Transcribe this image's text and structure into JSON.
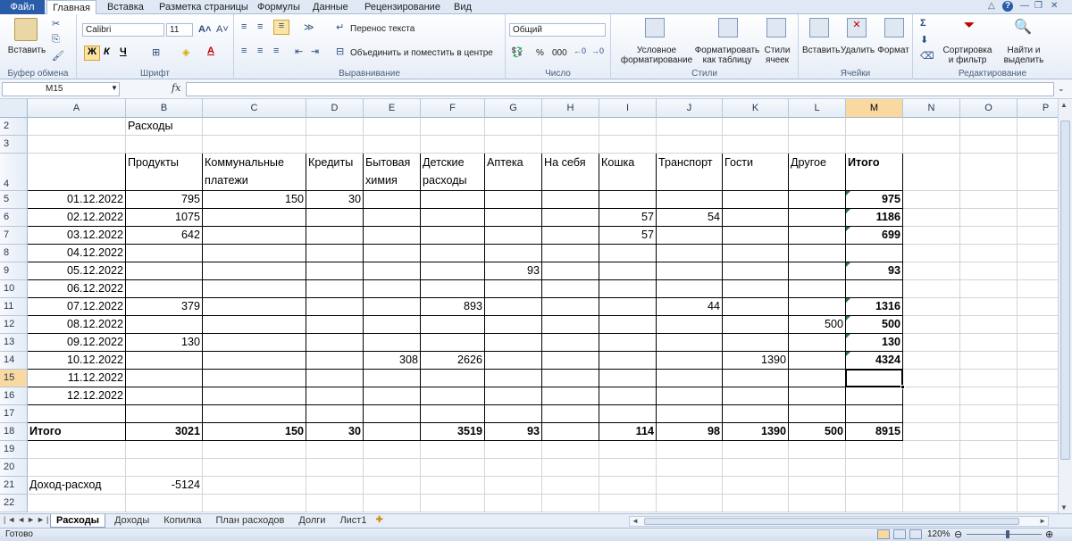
{
  "ribbon_tabs": [
    "Файл",
    "Главная",
    "Вставка",
    "Разметка страницы",
    "Формулы",
    "Данные",
    "Рецензирование",
    "Вид"
  ],
  "clipboard": {
    "paste": "Вставить",
    "label": "Буфер обмена"
  },
  "font": {
    "name": "Calibri",
    "size": "11",
    "bold": "Ж",
    "italic": "К",
    "underline": "Ч",
    "label": "Шрифт"
  },
  "alignment": {
    "wrap": "Перенос текста",
    "merge": "Объединить и поместить в центре",
    "label": "Выравнивание"
  },
  "number": {
    "format": "Общий",
    "percent": "%",
    "thousands": "000",
    "label": "Число"
  },
  "styles": {
    "conditional_1": "Условное",
    "conditional_2": "форматирование",
    "table_1": "Форматировать",
    "table_2": "как таблицу",
    "cell_1": "Стили",
    "cell_2": "ячеек",
    "label": "Стили"
  },
  "cells_group": {
    "insert": "Вставить",
    "delete": "Удалить",
    "format": "Формат",
    "label": "Ячейки"
  },
  "editing": {
    "sort_1": "Сортировка",
    "sort_2": "и фильтр",
    "find_1": "Найти и",
    "find_2": "выделить",
    "label": "Редактирование"
  },
  "formula_bar": {
    "name_box": "M15",
    "fx": "fx",
    "content": ""
  },
  "columns": [
    "A",
    "B",
    "C",
    "D",
    "E",
    "F",
    "G",
    "H",
    "I",
    "J",
    "K",
    "L",
    "M",
    "N",
    "O",
    "P"
  ],
  "rows": [
    "2",
    "3",
    "4",
    "5",
    "6",
    "7",
    "8",
    "9",
    "10",
    "11",
    "12",
    "13",
    "14",
    "15",
    "16",
    "17",
    "18",
    "19",
    "20",
    "21",
    "22"
  ],
  "cells": {
    "title": "Расходы",
    "headers": [
      "Продукты",
      "Коммунальные платежи",
      "Кредиты",
      "Бытовая химия",
      "Детские расходы",
      "Аптека",
      "На себя",
      "Кошка",
      "Транспорт",
      "Гости",
      "Другое",
      "Итого"
    ],
    "dates": [
      "01.12.2022",
      "02.12.2022",
      "03.12.2022",
      "04.12.2022",
      "05.12.2022",
      "06.12.2022",
      "07.12.2022",
      "08.12.2022",
      "09.12.2022",
      "10.12.2022",
      "11.12.2022",
      "12.12.2022"
    ],
    "data": [
      [
        "795",
        "150",
        "30",
        "",
        "",
        "",
        "",
        "",
        "",
        "",
        "",
        "975"
      ],
      [
        "1075",
        "",
        "",
        "",
        "",
        "",
        "",
        "57",
        "54",
        "",
        "",
        "1186"
      ],
      [
        "642",
        "",
        "",
        "",
        "",
        "",
        "",
        "57",
        "",
        "",
        "",
        "699"
      ],
      [
        "",
        "",
        "",
        "",
        "",
        "",
        "",
        "",
        "",
        "",
        "",
        ""
      ],
      [
        "",
        "",
        "",
        "",
        "",
        "93",
        "",
        "",
        "",
        "",
        "",
        "93"
      ],
      [
        "",
        "",
        "",
        "",
        "",
        "",
        "",
        "",
        "",
        "",
        "",
        ""
      ],
      [
        "379",
        "",
        "",
        "",
        "893",
        "",
        "",
        "",
        "44",
        "",
        "",
        "1316"
      ],
      [
        "",
        "",
        "",
        "",
        "",
        "",
        "",
        "",
        "",
        "",
        "500",
        "500"
      ],
      [
        "130",
        "",
        "",
        "",
        "",
        "",
        "",
        "",
        "",
        "",
        "",
        "130"
      ],
      [
        "",
        "",
        "",
        "308",
        "2626",
        "",
        "",
        "",
        "",
        "1390",
        "",
        "4324"
      ],
      [
        "",
        "",
        "",
        "",
        "",
        "",
        "",
        "",
        "",
        "",
        "",
        ""
      ],
      [
        "",
        "",
        "",
        "",
        "",
        "",
        "",
        "",
        "",
        "",
        "",
        ""
      ]
    ],
    "total_label": "Итого",
    "totals": [
      "3021",
      "150",
      "30",
      "",
      "3519",
      "93",
      "",
      "114",
      "98",
      "1390",
      "500",
      "8915"
    ],
    "income_label": "Доход-расход",
    "income_value": "-5124"
  },
  "sheet_tabs": [
    "Расходы",
    "Доходы",
    "Копилка",
    "План расходов",
    "Долги",
    "Лист1"
  ],
  "status": {
    "ready": "Готово",
    "zoom": "120%"
  }
}
